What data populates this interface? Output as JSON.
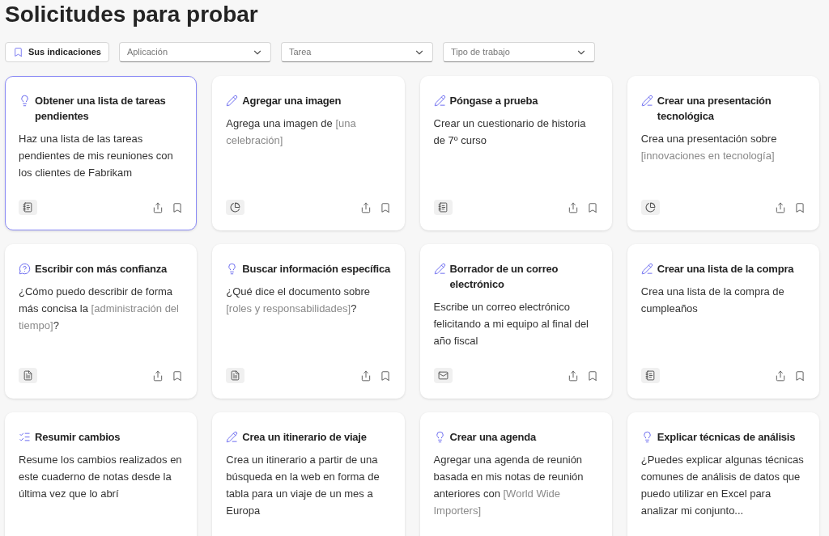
{
  "page_title": "Solicitudes para probar",
  "filters": [
    {
      "kind": "toggle",
      "label": "Sus indicaciones"
    },
    {
      "kind": "dropdown",
      "placeholder": "Aplicación"
    },
    {
      "kind": "dropdown",
      "placeholder": "Tarea"
    },
    {
      "kind": "dropdown",
      "placeholder": "Tipo de trabajo"
    }
  ],
  "cards": [
    {
      "selected": true,
      "title": "Obtener una lista de tareas pendientes",
      "description": [
        {
          "kind": "text",
          "text": "Haz una lista de las tareas pendientes de mis reuniones con los clientes de Fabrikam"
        }
      ]
    },
    {
      "selected": false,
      "title": "Agregar una imagen",
      "description": [
        {
          "kind": "text",
          "text": "Agrega una imagen de "
        },
        {
          "kind": "fill",
          "text": "[una celebración]"
        }
      ]
    },
    {
      "selected": false,
      "title": "Póngase a prueba",
      "description": [
        {
          "kind": "text",
          "text": "Crear un cuestionario de historia de 7º curso"
        }
      ]
    },
    {
      "selected": false,
      "title": "Crear una presentación tecnológica",
      "description": [
        {
          "kind": "text",
          "text": "Crea una presentación sobre "
        },
        {
          "kind": "fill",
          "text": "[innovaciones en tecnología]"
        }
      ]
    },
    {
      "selected": false,
      "title": "Escribir con más confianza",
      "description": [
        {
          "kind": "text",
          "text": "¿Cómo puedo describir de forma más concisa la "
        },
        {
          "kind": "fill",
          "text": "[administración del tiempo]"
        },
        {
          "kind": "text",
          "text": "?"
        }
      ]
    },
    {
      "selected": false,
      "title": "Buscar información específica",
      "description": [
        {
          "kind": "text",
          "text": "¿Qué dice el documento sobre "
        },
        {
          "kind": "fill",
          "text": "[roles y responsabilidades]"
        },
        {
          "kind": "text",
          "text": "?"
        }
      ]
    },
    {
      "selected": false,
      "title": "Borrador de un correo electrónico",
      "description": [
        {
          "kind": "text",
          "text": "Escribe un correo electrónico felicitando a mi equipo al final del año fiscal"
        }
      ]
    },
    {
      "selected": false,
      "title": "Crear una lista de la compra",
      "description": [
        {
          "kind": "text",
          "text": "Crea una lista de la compra de cumpleaños"
        }
      ]
    },
    {
      "selected": false,
      "title": "Resumir cambios",
      "description": [
        {
          "kind": "text",
          "text": "Resume los cambios realizados en este cuaderno de notas desde la última vez que lo abrí"
        }
      ]
    },
    {
      "selected": false,
      "title": "Crea un itinerario de viaje",
      "description": [
        {
          "kind": "text",
          "text": "Crea un itinerario a partir de una búsqueda en la web en forma de tabla para un viaje de un mes a Europa"
        }
      ]
    },
    {
      "selected": false,
      "title": "Crear una agenda",
      "description": [
        {
          "kind": "text",
          "text": "Agregar una agenda de reunión basada en mis notas de reunión anteriores con "
        },
        {
          "kind": "fill",
          "text": "[World Wide Importers]"
        }
      ]
    },
    {
      "selected": false,
      "title": "Explicar técnicas de análisis",
      "description": [
        {
          "kind": "text",
          "text": "¿Puedes explicar algunas técnicas comunes de análisis de datos que puedo utilizar en Excel para analizar mi conjunto..."
        }
      ]
    }
  ]
}
